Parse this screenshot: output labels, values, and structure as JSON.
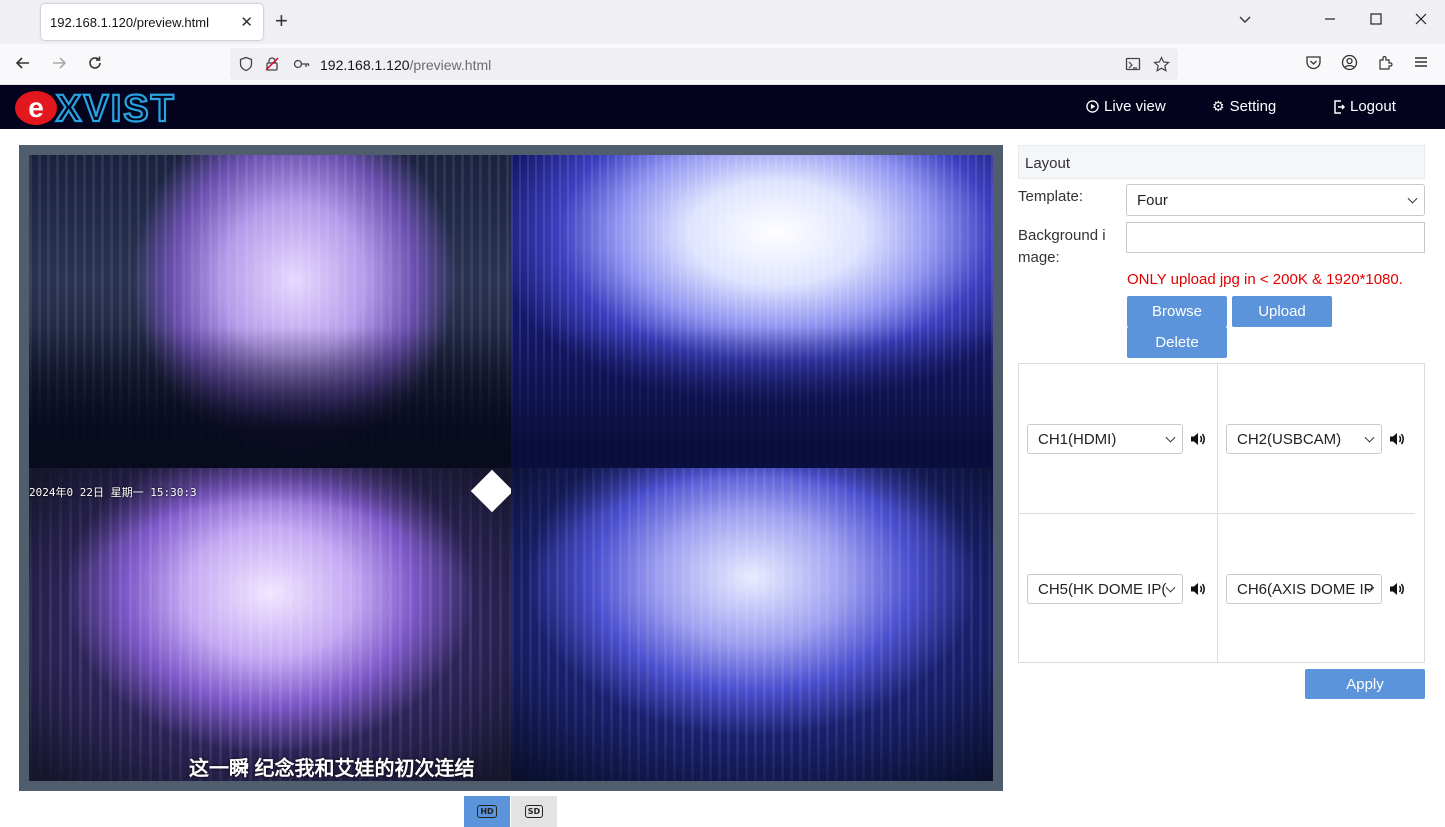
{
  "browser": {
    "tab_title": "192.168.1.120/preview.html",
    "url_host": "192.168.1.120",
    "url_path": "/preview.html"
  },
  "header": {
    "logo_text": "eXVIST",
    "menu": [
      {
        "label": "Live view",
        "icon": "play-circle-icon"
      },
      {
        "label": "Setting",
        "icon": "gear-icon"
      },
      {
        "label": "Logout",
        "icon": "logout-icon"
      }
    ]
  },
  "video": {
    "osd_time": "2024年0   22日  星期一  15:30:3",
    "subtitle": "这一瞬  纪念我和艾娃的初次连结",
    "quality_buttons": [
      {
        "label": "HD",
        "active": true
      },
      {
        "label": "SD",
        "active": false
      }
    ]
  },
  "layout_panel": {
    "title": "Layout",
    "template_label": "Template:",
    "template_value": "Four",
    "background_label": "Background image:",
    "background_value": "",
    "warning": "ONLY upload jpg in < 200K & 1920*1080.",
    "browse_label": "Browse",
    "upload_label": "Upload",
    "delete_label": "Delete",
    "channels": [
      {
        "value": "CH1(HDMI)"
      },
      {
        "value": "CH2(USBCAM)"
      },
      {
        "value": "CH5(HK DOME IP("
      },
      {
        "value": "CH6(AXIS DOME IP"
      }
    ],
    "apply_label": "Apply"
  },
  "colors": {
    "accent": "#5b94db",
    "header_bg": "#03031e",
    "warning": "#e00000",
    "frame": "#4f5d6d"
  }
}
